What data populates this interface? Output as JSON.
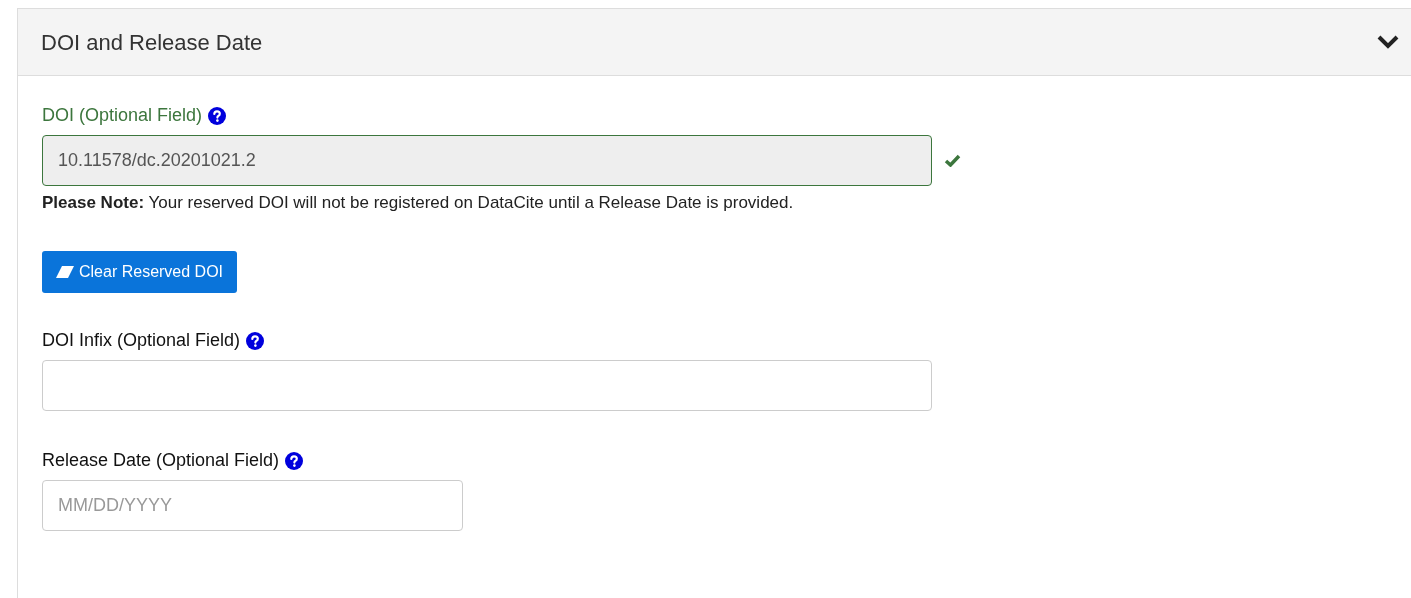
{
  "panel": {
    "title": "DOI and Release Date",
    "expanded": true
  },
  "doi": {
    "label": "DOI (Optional Field)",
    "value": "10.11578/dc.20201021.2",
    "valid": true,
    "disabled": true
  },
  "note": "**Please Note:** Your reserved DOI will not be registered on DataCite until a Release Date is provided.",
  "clear_button": "Clear Reserved DOI",
  "infix": {
    "label": "DOI Infix (Optional Field)",
    "valid": false,
    "disabled": false
  },
  "release_date": {
    "label": "Release Date (Optional Field)",
    "placeholder": "MM/DD/YYYY",
    "valid": false,
    "disabled": false
  }
}
